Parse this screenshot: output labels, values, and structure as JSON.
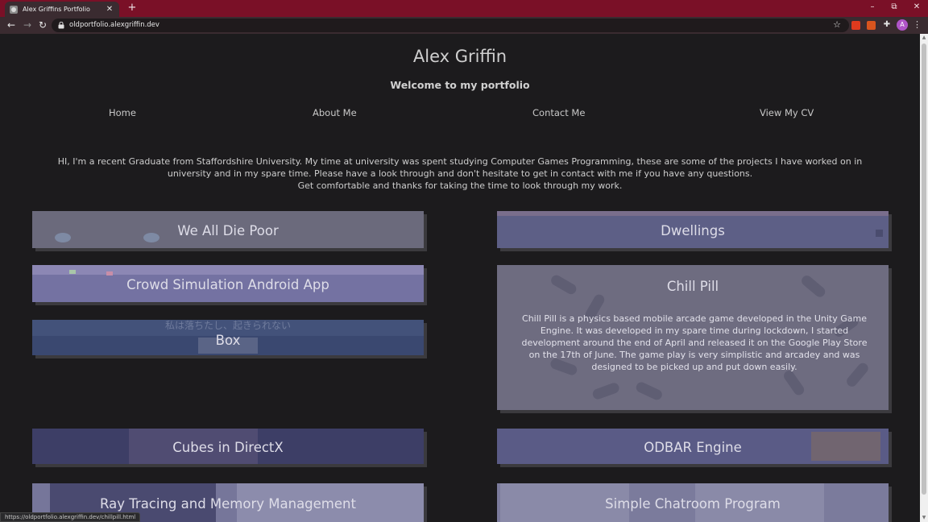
{
  "browser": {
    "tab_title": "Alex Griffins Portfolio",
    "tab_close": "✕",
    "new_tab": "+",
    "url": "oldportfolio.alexgriffin.dev",
    "profile_initial": "A",
    "window_controls": {
      "minimize": "–",
      "restore": "⧉",
      "close": "✕"
    },
    "nav": {
      "back": "←",
      "forward": "→",
      "reload": "↻"
    },
    "star": "☆",
    "menu": "⋮",
    "extensions": [
      "#e03a1e",
      "#d9541e",
      "#c9302c"
    ],
    "status_url": "https://oldportfolio.alexgriffin.dev/chillpill.html"
  },
  "page": {
    "title": "Alex Griffin",
    "subtitle": "Welcome to my portfolio",
    "nav": [
      "Home",
      "About Me",
      "Contact Me",
      "View My CV"
    ],
    "intro": [
      "HI, I'm a recent Graduate from Staffordshire University. My time at university was spent studying Computer Games Programming, these are some of the projects I have worked on in university and in my spare time. Please have a look through and don't hesitate to get in contact with me if you have any questions.",
      "Get comfortable and thanks for taking the time to look through my work."
    ]
  },
  "projects": [
    {
      "title": "We All Die Poor"
    },
    {
      "title": "Dwellings"
    },
    {
      "title": "Crowd Simulation Android App"
    },
    {
      "title": "Chill Pill",
      "description": "Chill Pill is a physics based mobile arcade game developed in the Unity Game Engine. It was developed in my spare time during lockdown, I started development around the end of April and released it on the Google Play Store on the 17th of June. The game play is very simplistic and arcadey and was designed to be picked up and put down easily."
    },
    {
      "title": "Box",
      "overlay_text": "私は落ちたし、起きられない"
    },
    {
      "title": "Cubes in DirectX"
    },
    {
      "title": "ODBAR Engine"
    },
    {
      "title": "Ray Tracing and Memory Management"
    },
    {
      "title": "Simple Chatroom Program"
    }
  ],
  "colors": {
    "chrome_tabbar": "#7a1027",
    "chrome_toolbar": "#3a2b30",
    "page_bg": "#1c1b1d",
    "card_bg": "#6c6a88"
  }
}
